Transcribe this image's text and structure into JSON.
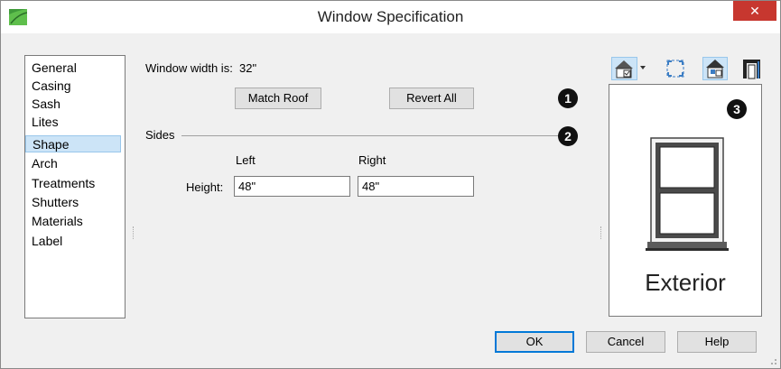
{
  "window": {
    "title": "Window Specification",
    "close_glyph": "✕"
  },
  "sidebar": {
    "items": [
      {
        "label": "General"
      },
      {
        "label": "Casing"
      },
      {
        "label": "Sash"
      },
      {
        "label": "Lites"
      },
      {
        "label": "Shape",
        "selected": true
      },
      {
        "label": "Arch"
      },
      {
        "label": "Treatments"
      },
      {
        "label": "Shutters"
      },
      {
        "label": "Materials"
      },
      {
        "label": "Label"
      }
    ]
  },
  "main": {
    "width_label": "Window width is:",
    "width_value": "32\"",
    "match_roof_label": "Match Roof",
    "revert_all_label": "Revert All",
    "sides_label": "Sides",
    "left_label": "Left",
    "right_label": "Right",
    "height_label": "Height:",
    "height_left_value": "48\"",
    "height_right_value": "48\""
  },
  "callouts": {
    "one": "1",
    "two": "2",
    "three": "3"
  },
  "preview": {
    "caption": "Exterior",
    "toolbar_icons": [
      "view-angle-icon",
      "fill-window-icon",
      "color-toggle-icon",
      "show-casing-icon"
    ]
  },
  "footer": {
    "ok_label": "OK",
    "cancel_label": "Cancel",
    "help_label": "Help"
  },
  "colors": {
    "close": "#c7372f",
    "selection": "#cce4f7",
    "default_border": "#0078d7"
  }
}
